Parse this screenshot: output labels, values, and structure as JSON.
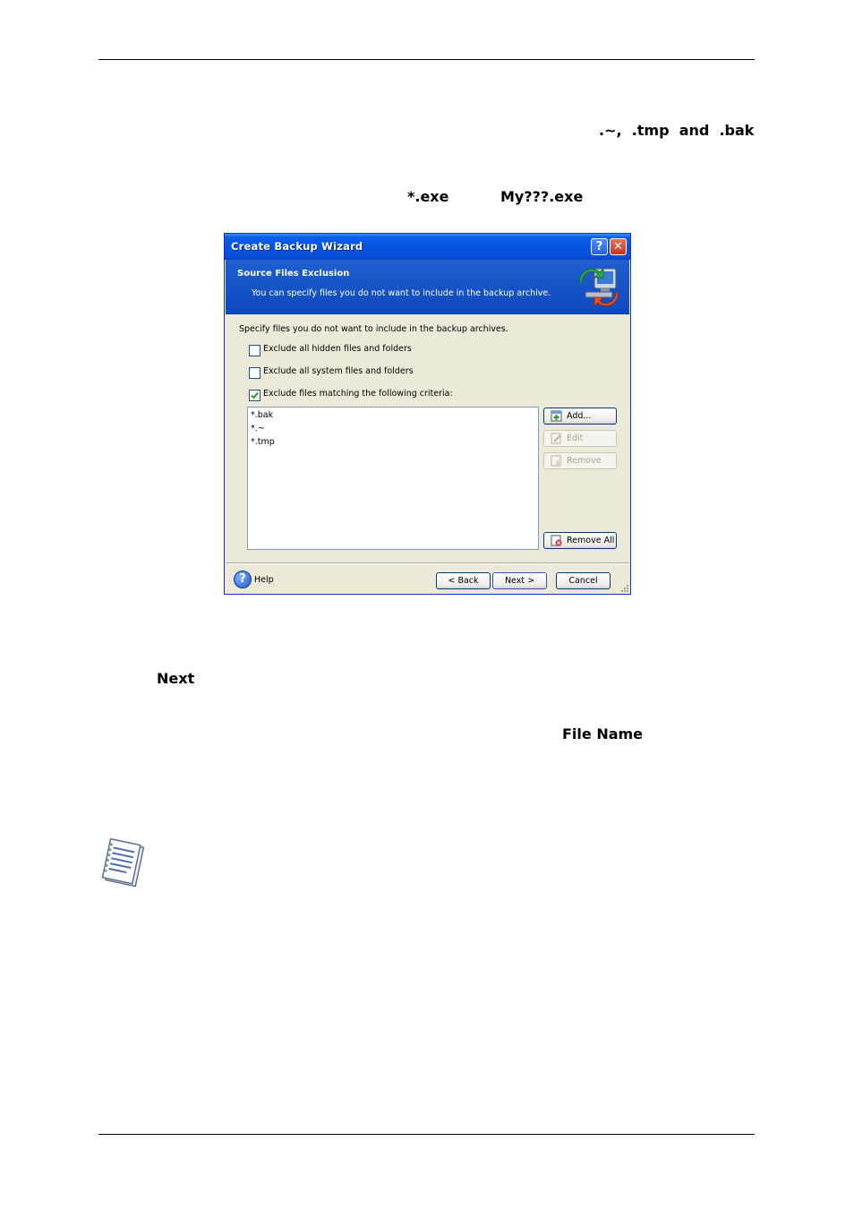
{
  "doc": {
    "frag_ext": ".~,  .tmp  and  .bak",
    "frag_exe": "*.exe",
    "frag_my": "My???.exe",
    "frag_next": "Next",
    "frag_filename": "File Name"
  },
  "dialog": {
    "title": "Create Backup Wizard",
    "help_glyph": "?",
    "close_glyph": "✕",
    "header_title": "Source Files Exclusion",
    "header_subtitle": "You can specify files you do not want to include in the backup archive.",
    "instruction": "Specify files you do not want to include in the backup archives.",
    "checkboxes": [
      {
        "label": "Exclude all hidden files and folders",
        "checked": false
      },
      {
        "label": "Exclude all system files and folders",
        "checked": false
      },
      {
        "label": "Exclude files matching the following criteria:",
        "checked": true
      }
    ],
    "criteria": [
      "*.bak",
      "*.~",
      "*.tmp"
    ],
    "buttons": {
      "add": "Add...",
      "edit": "Edit",
      "remove": "Remove",
      "remove_all": "Remove All",
      "back": "< Back",
      "next": "Next >",
      "cancel": "Cancel",
      "help": "Help"
    }
  },
  "colors": {
    "titlebar": "#0553e0",
    "header": "#1f5fd0",
    "dialog_bg": "#ece9d8"
  }
}
